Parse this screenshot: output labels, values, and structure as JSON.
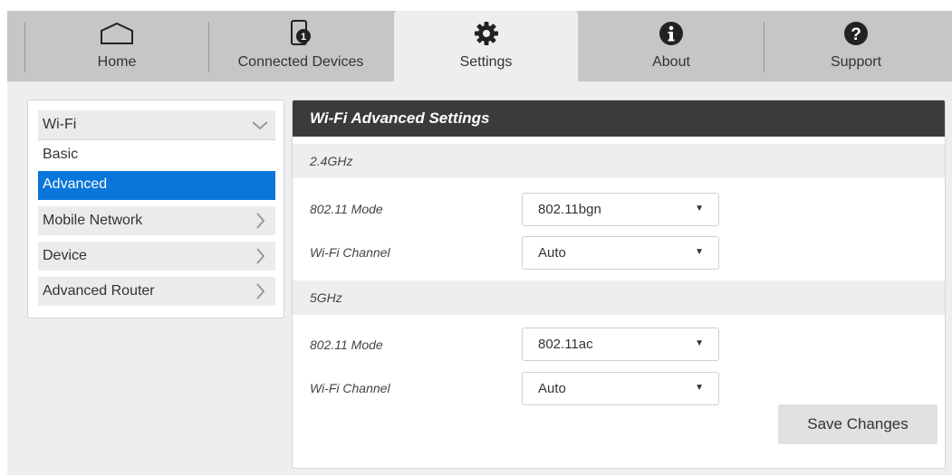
{
  "topnav": {
    "tabs": [
      {
        "label": "Home",
        "icon": "home-icon"
      },
      {
        "label": "Connected Devices",
        "icon": "connected-devices-icon"
      },
      {
        "label": "Settings",
        "icon": "gear-icon",
        "active": true
      },
      {
        "label": "About",
        "icon": "info-icon"
      },
      {
        "label": "Support",
        "icon": "help-icon"
      }
    ]
  },
  "sidebar": {
    "wifi": {
      "label": "Wi-Fi",
      "expanded": true
    },
    "wifi_basic": "Basic",
    "wifi_advanced": {
      "label": "Advanced",
      "selected": true
    },
    "mobile_network": "Mobile Network",
    "device": "Device",
    "advanced_router": "Advanced Router"
  },
  "panel": {
    "title": "Wi-Fi Advanced Settings",
    "band_24": {
      "header": "2.4GHz",
      "mode_label": "802.11 Mode",
      "mode_value": "802.11bgn",
      "channel_label": "Wi-Fi Channel",
      "channel_value": "Auto"
    },
    "band_5": {
      "header": "5GHz",
      "mode_label": "802.11 Mode",
      "mode_value": "802.11ac",
      "channel_label": "Wi-Fi Channel",
      "channel_value": "Auto"
    },
    "save_label": "Save Changes"
  },
  "colors": {
    "nav_bg": "#c6c6c6",
    "page_bg": "#eeeeee",
    "selected": "#0a76d9",
    "panel_title_bg": "#3b3b3b"
  }
}
